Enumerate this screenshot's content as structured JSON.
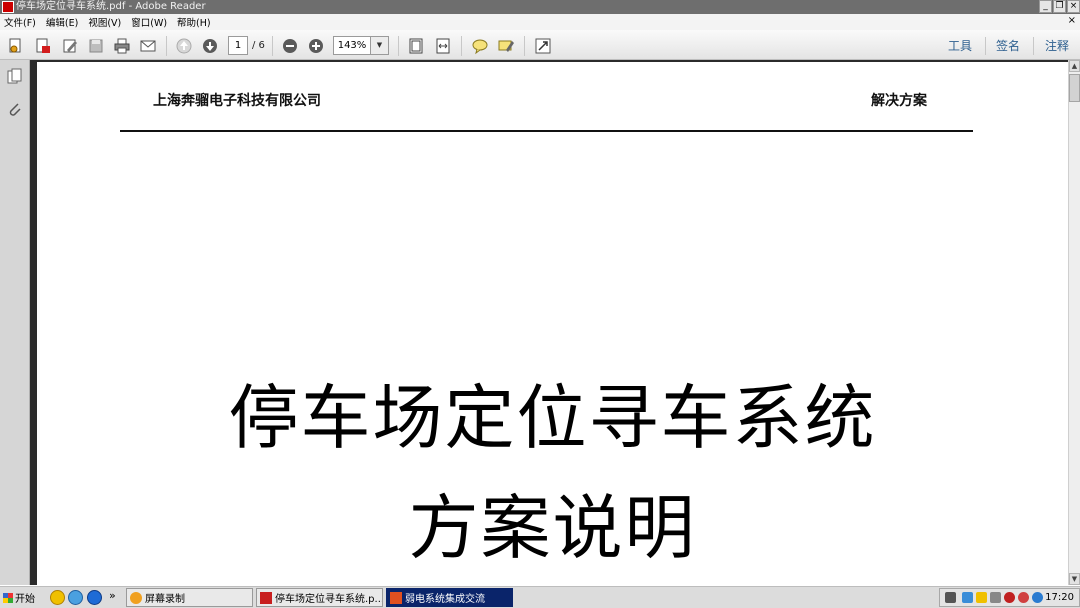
{
  "window": {
    "title": "停车场定位寻车系统.pdf - Adobe Reader",
    "buttons": {
      "minimize": "_",
      "restore": "❐",
      "close": "×"
    }
  },
  "menu": {
    "items": [
      {
        "label": "文件(F)"
      },
      {
        "label": "编辑(E)"
      },
      {
        "label": "视图(V)"
      },
      {
        "label": "窗口(W)"
      },
      {
        "label": "帮助(H)"
      }
    ],
    "close_label": "×"
  },
  "toolbar": {
    "page_current": "1",
    "page_total": "/ 6",
    "zoom_value": "143%",
    "zoom_arrow": "▼",
    "right_tabs": [
      {
        "label": "工具"
      },
      {
        "label": "签名"
      },
      {
        "label": "注释"
      }
    ]
  },
  "document": {
    "header_company": "上海奔骝电子科技有限公司",
    "header_label": "解决方案",
    "title_line1": "停车场定位寻车系统",
    "title_line2": "方案说明"
  },
  "scrollbar": {
    "up_arrow": "▲",
    "down_arrow": "▼"
  },
  "taskbar": {
    "start_label": "开始",
    "more_label": "»",
    "tasks": [
      {
        "label": "屏幕录制"
      },
      {
        "label": "停车场定位寻车系统.p..."
      },
      {
        "label": "弱电系统集成交流"
      }
    ],
    "clock": "17:20"
  },
  "colors": {
    "accent_tab_text": "#2d5f8f",
    "active_task": "#0a246a",
    "doc_background": "#2b2b2b"
  }
}
